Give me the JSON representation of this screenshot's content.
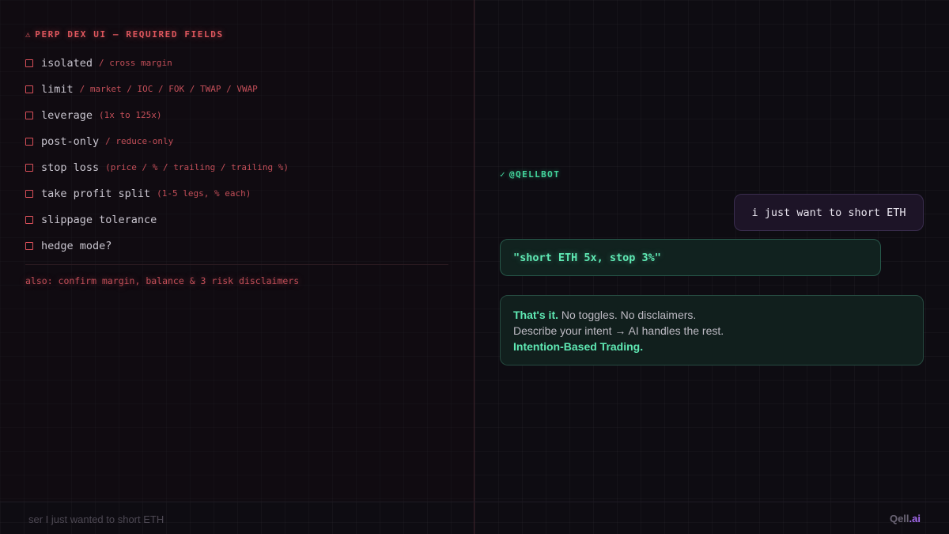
{
  "left": {
    "heading_icon": "⚠",
    "heading": "PERP DEX UI — REQUIRED FIELDS",
    "fields": [
      {
        "label": "isolated",
        "detail": "/ cross margin"
      },
      {
        "label": "limit",
        "detail": "/ market / IOC / FOK / TWAP / VWAP"
      },
      {
        "label": "leverage",
        "detail": "(1x to 125x)"
      },
      {
        "label": "post-only",
        "detail": "/ reduce-only"
      },
      {
        "label": "stop loss",
        "detail": "(price / % / trailing / trailing %)"
      },
      {
        "label": "take profit split",
        "detail": "(1-5 legs, % each)"
      },
      {
        "label": "slippage tolerance",
        "detail": ""
      },
      {
        "label": "hedge mode?",
        "detail": ""
      }
    ],
    "also_note": "also: confirm margin, balance & 3 risk disclaimers"
  },
  "right": {
    "bot_check_icon": "✓",
    "bot_handle": "@QELLBOT",
    "user_message": "i just want to short ETH",
    "bot_command": "\"short ETH 5x, stop 3%\"",
    "reply": {
      "line1_bold": "That's it.",
      "line1_rest": " No toggles. No disclaimers.",
      "line2": "Describe your intent → AI handles the rest.",
      "line3_bold": "Intention-Based Trading."
    }
  },
  "footer": {
    "caption": "ser I just wanted to short ETH",
    "logo_main": "Qell",
    "logo_suffix": ".ai"
  },
  "colors": {
    "warning_red": "#e0575e",
    "accent_green": "#5fe9b4",
    "brand_purple": "#a66bf0"
  },
  "icons": [
    "warning-icon",
    "checkbox-icon",
    "check-icon"
  ]
}
